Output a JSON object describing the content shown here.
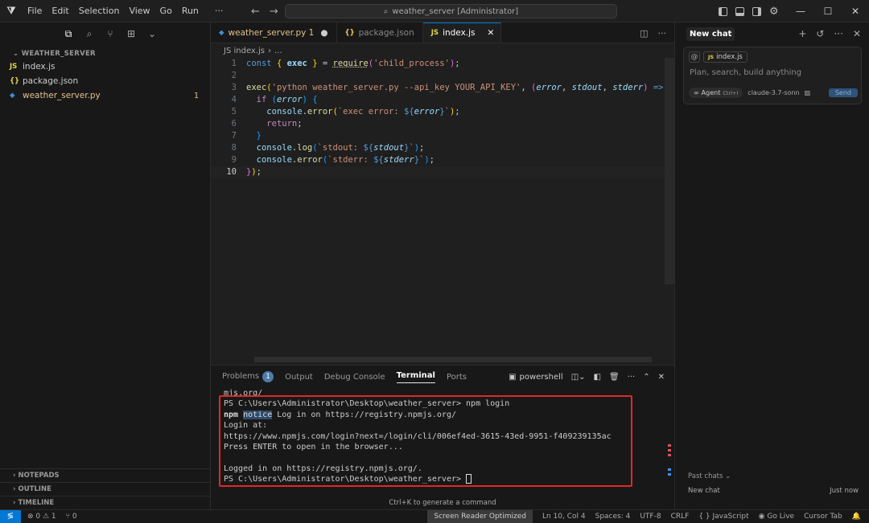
{
  "titlebar": {
    "menu": [
      "File",
      "Edit",
      "Selection",
      "View",
      "Go",
      "Run",
      "···"
    ],
    "search_text": "weather_server [Administrator]"
  },
  "sidebar": {
    "section_title": "WEATHER_SERVER",
    "files": [
      {
        "icon": "JS",
        "name": "index.js",
        "badge": "",
        "color": "#e8d44d",
        "name_color": "#cccccc"
      },
      {
        "icon": "{}",
        "name": "package.json",
        "badge": "",
        "color": "#e8d44d",
        "name_color": "#cccccc"
      },
      {
        "icon": "py",
        "name": "weather_server.py",
        "badge": "1",
        "color": "#3f8fd2",
        "name_color": "#e2c08d"
      }
    ],
    "bottom_sections": [
      "NOTEPADS",
      "OUTLINE",
      "TIMELINE"
    ]
  },
  "editor": {
    "tabs": [
      {
        "icon": "py",
        "label": "weather_server.py 1",
        "dirty": "●"
      },
      {
        "icon": "{}",
        "label": "package.json",
        "dirty": ""
      },
      {
        "icon": "JS",
        "label": "index.js",
        "dirty": "✕"
      }
    ],
    "breadcrumb": [
      "JS index.js",
      "›",
      "..."
    ],
    "line_numbers": [
      "1",
      "2",
      "3",
      "4",
      "5",
      "6",
      "7",
      "8",
      "9",
      "10"
    ]
  },
  "panel": {
    "tabs": [
      "Problems",
      "Output",
      "Debug Console",
      "Terminal",
      "Ports"
    ],
    "problems_count": "1",
    "shell_label": "powershell",
    "terminal_lines": [
      "mjs.org/",
      "PS C:\\Users\\Administrator\\Desktop\\weather_server> npm login",
      "npm notice Log in on https://registry.npmjs.org/",
      "Login at:",
      "https://www.npmjs.com/login?next=/login/cli/006ef4ed-3615-43ed-9951-f409239135ac",
      "Press ENTER to open in the browser...",
      "",
      "Logged in on https://registry.npmjs.org/.",
      "PS C:\\Users\\Administrator\\Desktop\\weather_server> "
    ],
    "hint": "Ctrl+K to generate a command"
  },
  "chat": {
    "title": "New chat",
    "context_file": "index.js",
    "placeholder": "Plan, search, build anything",
    "agent_label": "Agent",
    "agent_shortcut": "Ctrl+I",
    "model": "claude-3.7-sonn",
    "send_label": "Send",
    "past_chats_label": "Past chats ⌄",
    "past_item": "New chat",
    "past_item_time": "Just now"
  },
  "statusbar": {
    "errors": "⊗ 0 ⚠ 1",
    "ports": "⑂ 0",
    "screen_reader": "Screen Reader Optimized",
    "position": "Ln 10, Col 4",
    "spaces": "Spaces: 4",
    "encoding": "UTF-8",
    "eol": "CRLF",
    "language": "{ } JavaScript",
    "golive": "Go Live",
    "cursor_tab": "Cursor Tab"
  },
  "colors": {
    "accent": "#0078d4",
    "error_box": "#e02828"
  }
}
